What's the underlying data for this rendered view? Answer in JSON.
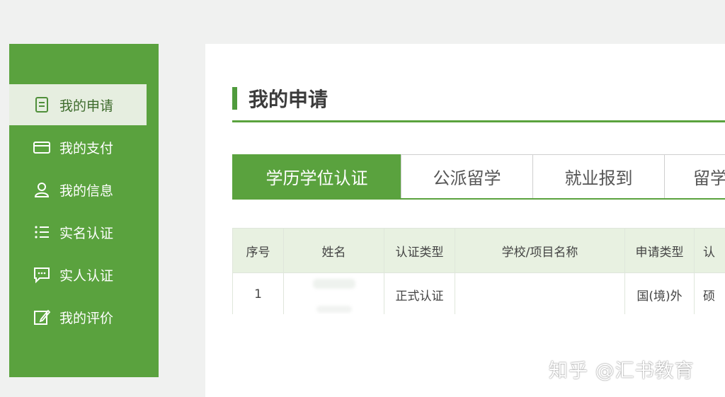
{
  "sidebar": {
    "items": [
      {
        "label": "我的申请",
        "icon": "document-icon",
        "active": true
      },
      {
        "label": "我的支付",
        "icon": "card-icon",
        "active": false
      },
      {
        "label": "我的信息",
        "icon": "user-icon",
        "active": false
      },
      {
        "label": "实名认证",
        "icon": "list-icon",
        "active": false
      },
      {
        "label": "实人认证",
        "icon": "chat-icon",
        "active": false
      },
      {
        "label": "我的评价",
        "icon": "edit-icon",
        "active": false
      }
    ]
  },
  "main": {
    "title": "我的申请",
    "tabs": [
      {
        "label": "学历学位认证",
        "active": true
      },
      {
        "label": "公派留学",
        "active": false
      },
      {
        "label": "就业报到",
        "active": false
      },
      {
        "label": "留学",
        "active": false
      }
    ],
    "table": {
      "headers": [
        "序号",
        "姓名",
        "认证类型",
        "学校/项目名称",
        "申请类型",
        "认"
      ],
      "rows": [
        [
          "1",
          "",
          "正式认证",
          "",
          "国(境)外",
          "硕"
        ]
      ]
    }
  },
  "watermark": "知乎 @汇书教育",
  "colors": {
    "accent": "#5aa23e",
    "header_bg": "#e8f1e1"
  }
}
